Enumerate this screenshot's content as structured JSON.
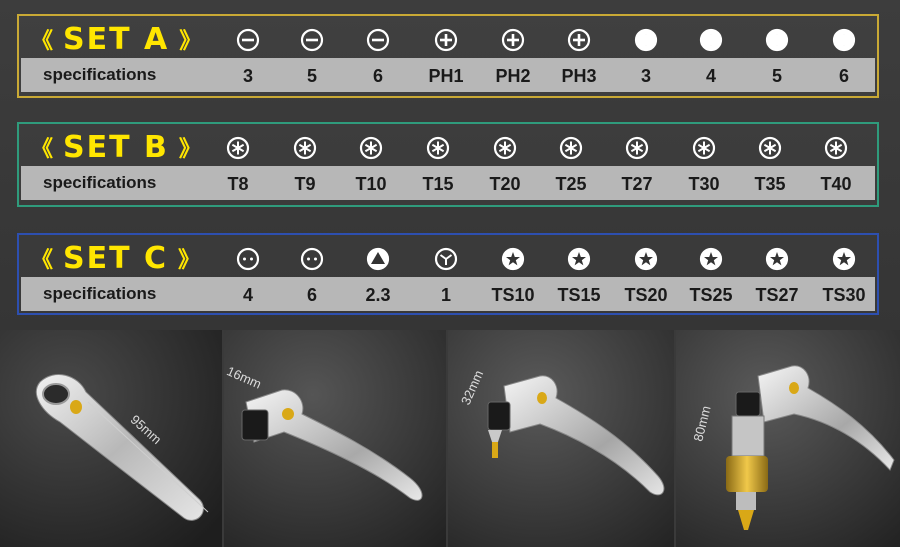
{
  "set_a": {
    "title": "SET A",
    "open": "《",
    "close": "》",
    "spec_label": "specifications",
    "items": [
      {
        "icon": "slotted-icon",
        "value": "3"
      },
      {
        "icon": "slotted-icon",
        "value": "5"
      },
      {
        "icon": "slotted-icon",
        "value": "6"
      },
      {
        "icon": "phillips-icon",
        "value": "PH1"
      },
      {
        "icon": "phillips-icon",
        "value": "PH2"
      },
      {
        "icon": "phillips-icon",
        "value": "PH3"
      },
      {
        "icon": "hex-icon",
        "value": "3"
      },
      {
        "icon": "hex-icon",
        "value": "4"
      },
      {
        "icon": "hex-icon",
        "value": "5"
      },
      {
        "icon": "hex-icon",
        "value": "6"
      }
    ]
  },
  "set_b": {
    "title": "SET B",
    "open": "《",
    "close": "》",
    "spec_label": "specifications",
    "items": [
      {
        "icon": "torx-icon",
        "value": "T8"
      },
      {
        "icon": "torx-icon",
        "value": "T9"
      },
      {
        "icon": "torx-icon",
        "value": "T10"
      },
      {
        "icon": "torx-icon",
        "value": "T15"
      },
      {
        "icon": "torx-icon",
        "value": "T20"
      },
      {
        "icon": "torx-icon",
        "value": "T25"
      },
      {
        "icon": "torx-icon",
        "value": "T27"
      },
      {
        "icon": "torx-icon",
        "value": "T30"
      },
      {
        "icon": "torx-icon",
        "value": "T35"
      },
      {
        "icon": "torx-icon",
        "value": "T40"
      }
    ]
  },
  "set_c": {
    "title": "SET C",
    "open": "《",
    "close": "》",
    "spec_label": "specifications",
    "items": [
      {
        "icon": "spanner-icon",
        "value": "4"
      },
      {
        "icon": "spanner-icon",
        "value": "6"
      },
      {
        "icon": "triangle-icon",
        "value": "2.3"
      },
      {
        "icon": "tri-wing-icon",
        "value": "1"
      },
      {
        "icon": "star-icon",
        "value": "TS10"
      },
      {
        "icon": "star-icon",
        "value": "TS15"
      },
      {
        "icon": "star-icon",
        "value": "TS20"
      },
      {
        "icon": "star-icon",
        "value": "TS25"
      },
      {
        "icon": "star-icon",
        "value": "TS27"
      },
      {
        "icon": "star-icon",
        "value": "TS30"
      }
    ]
  },
  "photos": {
    "p1_dim": "95mm",
    "p2_dim": "16mm",
    "p3_dim": "32mm",
    "p4_dim": "80mm"
  },
  "colors": {
    "set_a_border": "#c9a935",
    "set_b_border": "#2f9b7c",
    "set_c_border": "#2d4fb0",
    "title_yellow": "#ffe600",
    "spec_bar": "#b7b7b7"
  }
}
